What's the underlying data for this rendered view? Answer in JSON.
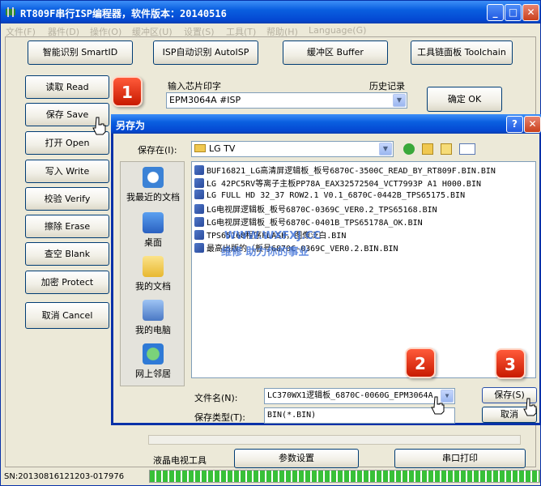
{
  "app": {
    "title": "RT809F串行ISP编程器，软件版本：20140516"
  },
  "menu": [
    "文件(F)",
    "器件(D)",
    "操作(O)",
    "缓冲区(U)",
    "设置(S)",
    "工具(T)",
    "帮助(H)",
    "Language(G)"
  ],
  "toolbar": {
    "smart_id": "智能识别 SmartID",
    "isp_auto": "ISP自动识别 AutoISP",
    "buffer": "缓冲区 Buffer",
    "toolchain": "工具链面板 Toolchain"
  },
  "actions": [
    "读取 Read",
    "保存 Save",
    "打开 Open",
    "写入 Write",
    "校验 Verify",
    "擦除 Erase",
    "查空 Blank",
    "加密 Protect",
    "取消 Cancel"
  ],
  "chip": {
    "label": "输入芯片印字",
    "history_label": "历史记录",
    "value": "EPM3064A #ISP",
    "ok": "确定 OK"
  },
  "dialog": {
    "title": "另存为",
    "save_in_label": "保存在(I):",
    "folder": "LG TV",
    "places": [
      "我最近的文档",
      "桌面",
      "我的文档",
      "我的电脑",
      "网上邻居"
    ],
    "files": [
      "BUF16821_LG高清屏逻辑板_板号6870C-3500C_READ_BY_RT809F.BIN.BIN",
      "LG 42PC5RV等离子主板PP78A_EAX32572504_VCT7993P A1 H000.BIN",
      "LG FULL HD 32_37 ROW2.1 V0.1_6870C-0442B_TPS65175.BIN",
      "LG电视屏逻辑板_板号6870C-0369C_VER0.2_TPS65168.BIN",
      "LG电视屏逻辑板_板号6870C-0401B_TPS65178A_OK.BIN",
      "TPS65168程序FLASH，图像泛白.BIN",
      "最高出版的（板号6870C-0369C_VER0.2.BIN.BIN"
    ],
    "filename_label": "文件名(N):",
    "filename": "LC370WX1逻辑板_6870C-0060G_EPM3064A",
    "filetype_label": "保存类型(T):",
    "filetype": "BIN(*.BIN)",
    "save": "保存(S)",
    "cancel": "取消"
  },
  "watermark": {
    "line1": "WWW.WXFXJ.CC",
    "line2": "维修  助力你的事业"
  },
  "bottom": {
    "lcd_tools": "液晶电视工具",
    "params": "参数设置",
    "serial_print": "串口打印"
  },
  "status": {
    "sn": "SN:20130816121203-017976"
  },
  "badges": [
    "1",
    "2",
    "3"
  ]
}
